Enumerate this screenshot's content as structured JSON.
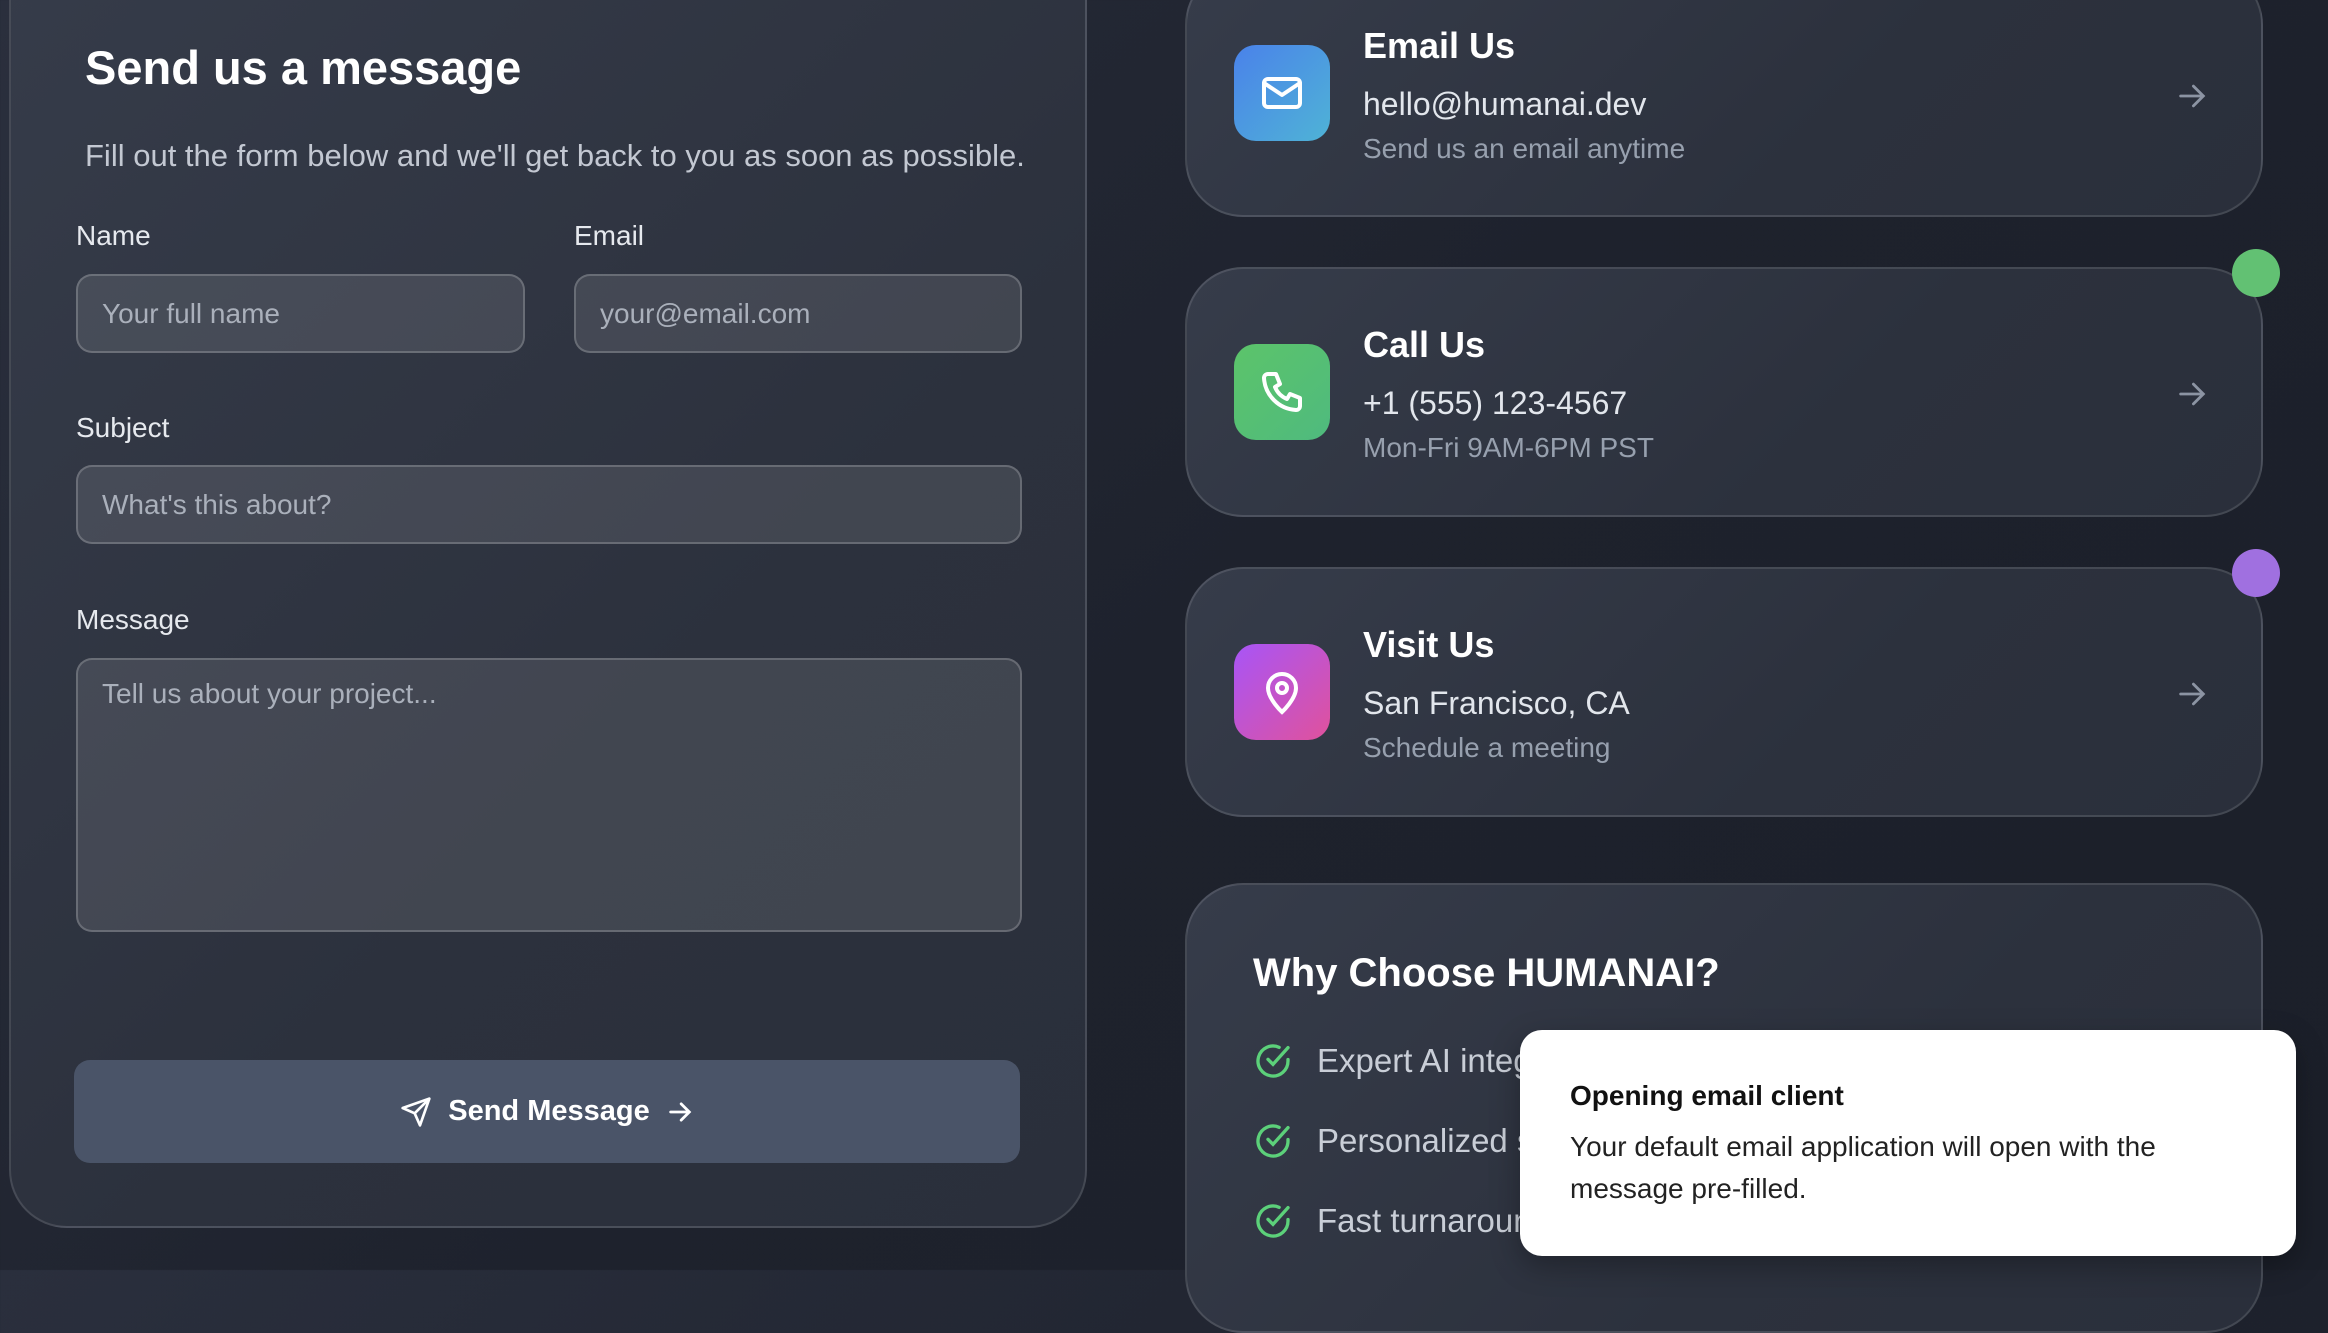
{
  "form": {
    "title": "Send us a message",
    "subtitle": "Fill out the form below and we'll get back to you as soon as possible.",
    "name_label": "Name",
    "name_placeholder": "Your full name",
    "email_label": "Email",
    "email_placeholder": "your@email.com",
    "subject_label": "Subject",
    "subject_placeholder": "What's this about?",
    "message_label": "Message",
    "message_placeholder": "Tell us about your project...",
    "submit_label": "Send Message"
  },
  "contacts": [
    {
      "title": "Email Us",
      "value": "hello@humanai.dev",
      "note": "Send us an email anytime",
      "icon": "mail-icon",
      "color": "#4a86e8"
    },
    {
      "title": "Call Us",
      "value": "+1 (555) 123-4567",
      "note": "Mon-Fri 9AM-6PM PST",
      "icon": "phone-icon",
      "color": "#5cc070"
    },
    {
      "title": "Visit Us",
      "value": "San Francisco, CA",
      "note": "Schedule a meeting",
      "icon": "map-pin-icon",
      "color": "#a855f7"
    }
  ],
  "why": {
    "title": "Why Choose HUMANAI?",
    "items": [
      "Expert AI integration",
      "Personalized solutions",
      "Fast turnaround"
    ]
  },
  "toast": {
    "title": "Opening email client",
    "body": "Your default email application will open with the message pre-filled."
  }
}
